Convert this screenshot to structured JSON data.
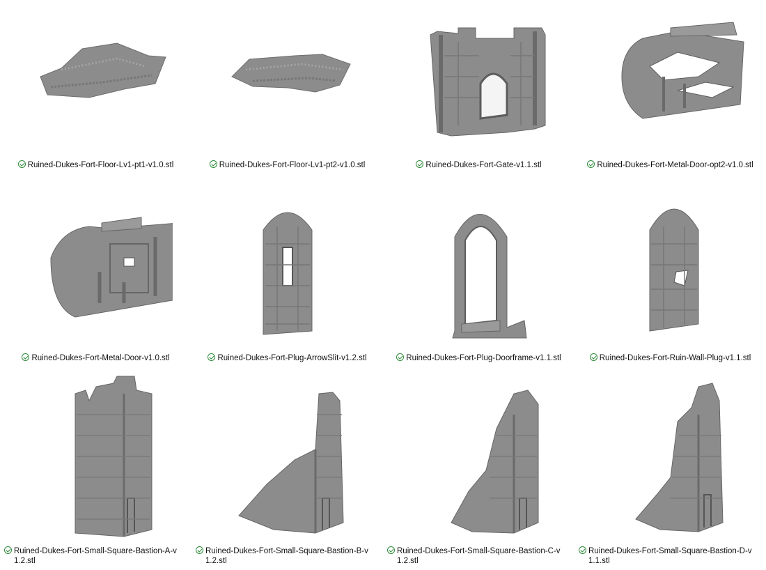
{
  "files": [
    {
      "name": "Ruined-Dukes-Fort-Floor-Lv1-pt1-v1.0.stl",
      "status_icon": "sync-ok-check-icon",
      "thumbnail": "floor-tile-model"
    },
    {
      "name": "Ruined-Dukes-Fort-Floor-Lv1-pt2-v1.0.stl",
      "status_icon": "sync-ok-check-icon",
      "thumbnail": "floor-tile-model"
    },
    {
      "name": "Ruined-Dukes-Fort-Gate-v1.1.stl",
      "status_icon": "sync-ok-check-icon",
      "thumbnail": "gate-wall-model"
    },
    {
      "name": "Ruined-Dukes-Fort-Metal-Door-opt2-v1.0.stl",
      "status_icon": "sync-ok-check-icon",
      "thumbnail": "broken-metal-door-model"
    },
    {
      "name": "Ruined-Dukes-Fort-Metal-Door-v1.0.stl",
      "status_icon": "sync-ok-check-icon",
      "thumbnail": "metal-door-model"
    },
    {
      "name": "Ruined-Dukes-Fort-Plug-ArrowSlit-v1.2.stl",
      "status_icon": "sync-ok-check-icon",
      "thumbnail": "arrowslit-plug-model"
    },
    {
      "name": "Ruined-Dukes-Fort-Plug-Doorframe-v1.1.stl",
      "status_icon": "sync-ok-check-icon",
      "thumbnail": "doorframe-plug-model"
    },
    {
      "name": "Ruined-Dukes-Fort-Ruin-Wall-Plug-v1.1.stl",
      "status_icon": "sync-ok-check-icon",
      "thumbnail": "ruin-wall-plug-model"
    },
    {
      "name_line1": "Ruined-Dukes-Fort-Small-Square-Bastion-A-v",
      "name_line2": "1.2.stl",
      "status_icon": "sync-ok-check-icon",
      "thumbnail": "bastion-tower-model"
    },
    {
      "name_line1": "Ruined-Dukes-Fort-Small-Square-Bastion-B-v",
      "name_line2": "1.2.stl",
      "status_icon": "sync-ok-check-icon",
      "thumbnail": "bastion-tower-model"
    },
    {
      "name_line1": "Ruined-Dukes-Fort-Small-Square-Bastion-C-v",
      "name_line2": "1.2.stl",
      "status_icon": "sync-ok-check-icon",
      "thumbnail": "bastion-tower-model"
    },
    {
      "name_line1": "Ruined-Dukes-Fort-Small-Square-Bastion-D-v",
      "name_line2": "1.1.stl",
      "status_icon": "sync-ok-check-icon",
      "thumbnail": "bastion-tower-model"
    }
  ],
  "colors": {
    "model_fill": "#8c8c8c",
    "model_dark": "#6a6a6a",
    "model_light": "#a9a9a9",
    "check": "#2e8b3a"
  }
}
